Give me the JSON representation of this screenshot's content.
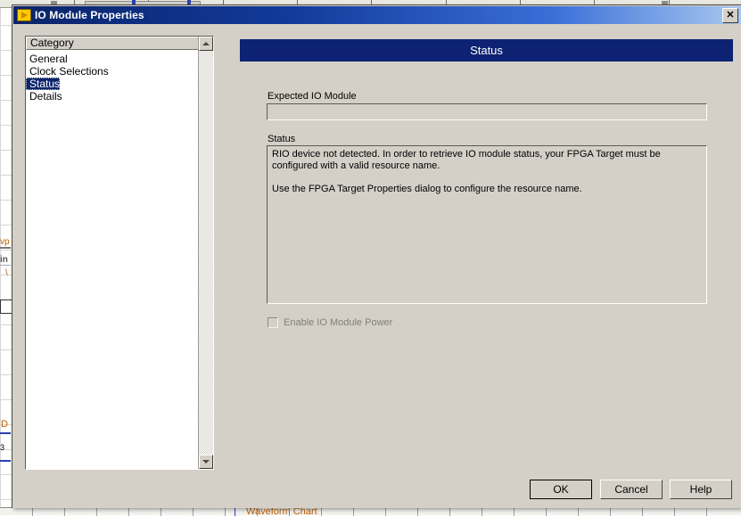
{
  "window": {
    "title": "IO Module Properties",
    "icon": "labview-run-arrow-icon",
    "close_label": "✕"
  },
  "category_list": {
    "header": "Category",
    "items": [
      {
        "label": "General",
        "selected": false
      },
      {
        "label": "Clock Selections",
        "selected": false
      },
      {
        "label": "Status",
        "selected": true
      },
      {
        "label": "Details",
        "selected": false
      }
    ]
  },
  "panel": {
    "header": "Status",
    "expected_module": {
      "label": "Expected IO Module",
      "value": "",
      "placeholder": ""
    },
    "status": {
      "label": "Status",
      "paragraphs": [
        "RIO device not detected.  In order to retrieve IO module status, your FPGA Target must be configured with a valid resource name.",
        "Use the FPGA Target Properties dialog to configure the resource name."
      ]
    },
    "enable_power": {
      "label": "Enable IO Module Power",
      "checked": false,
      "enabled": false
    }
  },
  "footer": {
    "ok_label": "OK",
    "cancel_label": "Cancel",
    "help_label": "Help"
  },
  "background": {
    "waveform_chart_label": "Waveform Chart",
    "fragments": [
      "vp",
      "in",
      "D",
      "3"
    ]
  },
  "colors": {
    "titlebar_start": "#0a246a",
    "titlebar_end": "#a8c8f0",
    "panel_header": "#0d2272",
    "dialog_face": "#d4d0c8",
    "selection": "#0a246a",
    "disabled_text": "#808078",
    "icon_yellow": "#ffcc00",
    "labview_orange": "#c06000"
  }
}
